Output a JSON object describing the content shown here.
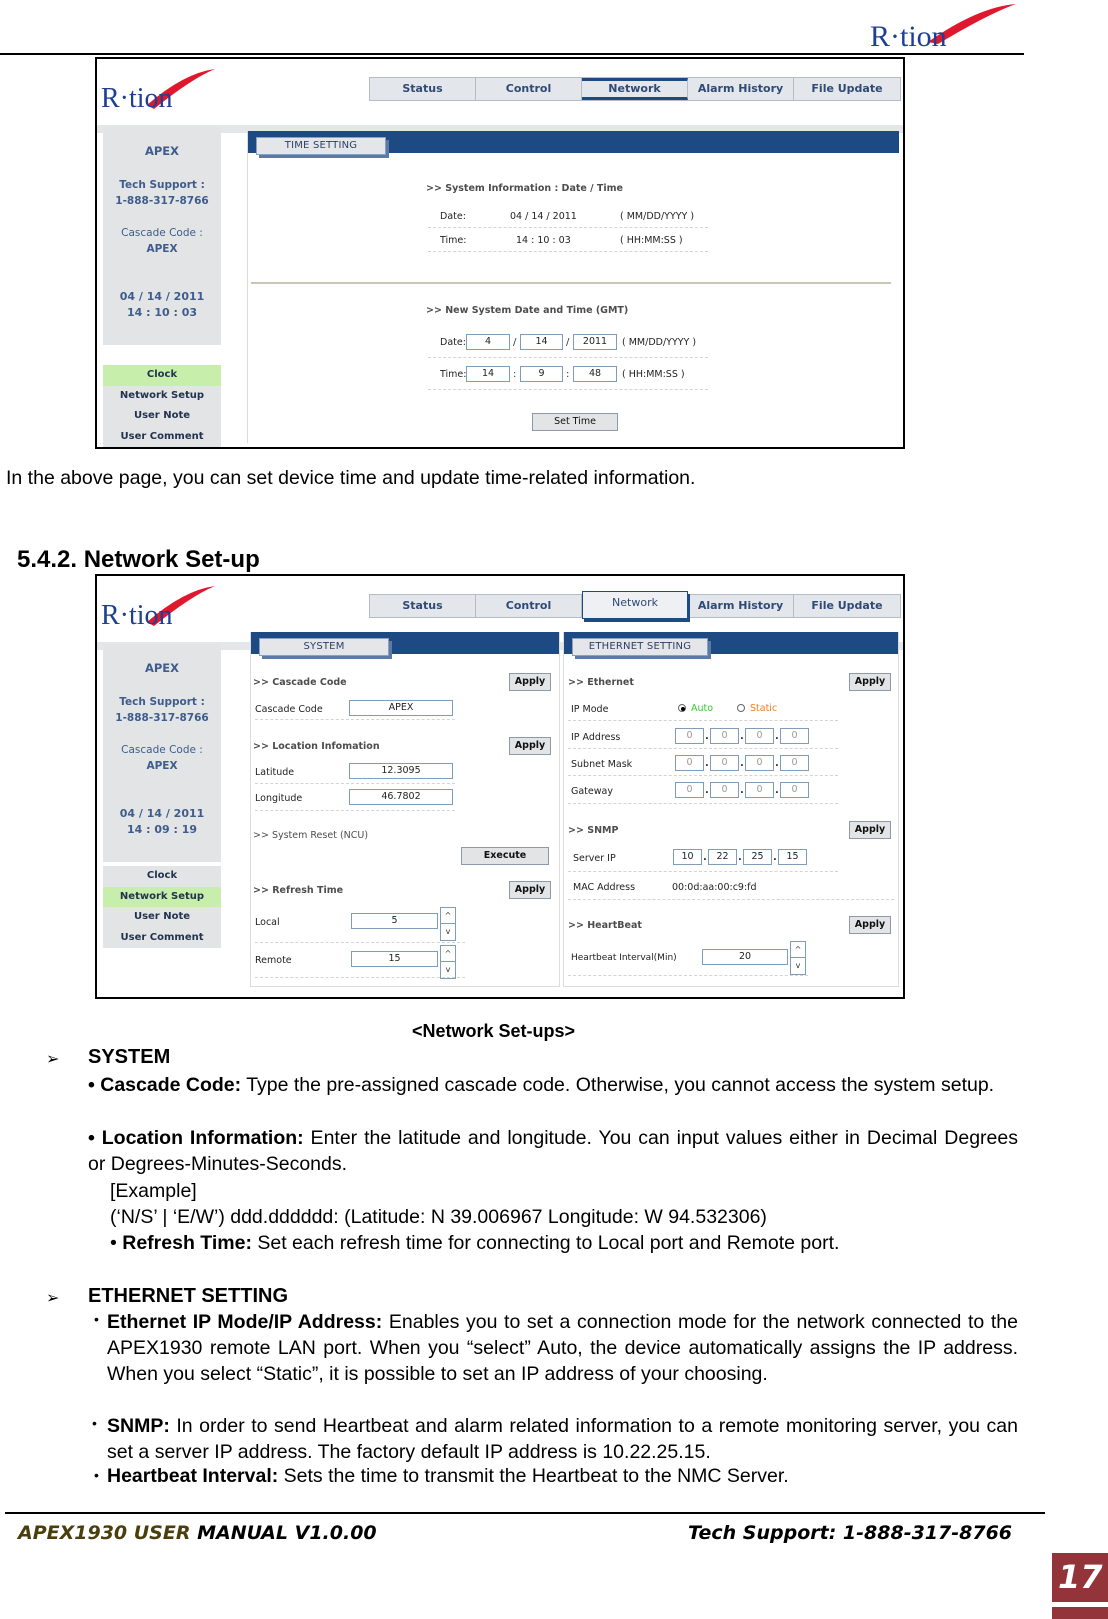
{
  "header": {
    "brand": "R·tion"
  },
  "shot1": {
    "nav_tabs": [
      {
        "label": "Status"
      },
      {
        "label": "Control"
      },
      {
        "label": "Network"
      },
      {
        "label": "Alarm History"
      },
      {
        "label": "File Update"
      }
    ],
    "active_tab": "Network",
    "sidebar_info": {
      "name": "APEX",
      "tech_support_label": "Tech Support :",
      "tech_support_phone": "1-888-317-8766",
      "cascade_label": "Cascade Code :",
      "cascade_value": "APEX",
      "date": "04 / 14 / 2011",
      "time": "14 : 10 : 03"
    },
    "sidebar_menu": [
      {
        "label": "Clock",
        "active": true
      },
      {
        "label": "Network Setup"
      },
      {
        "label": "User Note"
      },
      {
        "label": "User Comment"
      }
    ],
    "panel_title": "TIME SETTING",
    "sysinfo": {
      "title": ">> System Information : Date / Time",
      "date_label": "Date:",
      "date_value": "04 / 14 / 2011",
      "date_format": "( MM/DD/YYYY )",
      "time_label": "Time:",
      "time_value": "14 : 10 : 03",
      "time_format": "( HH:MM:SS )"
    },
    "newtime": {
      "title": ">> New System Date and Time (GMT)",
      "date_label": "Date:",
      "month": "4",
      "day": "14",
      "year": "2011",
      "date_sep": "/",
      "date_format": "( MM/DD/YYYY )",
      "time_label": "Time:",
      "hour": "14",
      "minute": "9",
      "second": "48",
      "time_sep": ":",
      "time_format": "( HH:MM:SS )",
      "button": "Set Time"
    }
  },
  "text1": "In the above page, you can set device time and update time-related information.",
  "section_heading": "5.4.2. Network Set-up",
  "shot2": {
    "nav_tabs": [
      {
        "label": "Status"
      },
      {
        "label": "Control"
      },
      {
        "label": "Network"
      },
      {
        "label": "Alarm History"
      },
      {
        "label": "File Update"
      }
    ],
    "sidebar_info": {
      "name": "APEX",
      "tech_support_label": "Tech Support :",
      "tech_support_phone": "1-888-317-8766",
      "cascade_label": "Cascade Code :",
      "cascade_value": "APEX",
      "date": "04 / 14 / 2011",
      "time": "14 : 09 : 19"
    },
    "sidebar_menu": [
      {
        "label": "Clock"
      },
      {
        "label": "Network Setup",
        "active": true
      },
      {
        "label": "User Note"
      },
      {
        "label": "User Comment"
      }
    ],
    "system": {
      "panel_title": "SYSTEM",
      "cascade_title": ">> Cascade Code",
      "cascade_label": "Cascade Code",
      "cascade_value": "APEX",
      "location_title": ">> Location Infomation",
      "lat_label": "Latitude",
      "lat_value": "12.3095",
      "lon_label": "Longitude",
      "lon_value": "46.7802",
      "reset_title": ">> System Reset (NCU)",
      "execute": "Execute",
      "refresh_title": ">> Refresh Time",
      "local_label": "Local",
      "local_value": "5",
      "remote_label": "Remote",
      "remote_value": "15",
      "apply": "Apply",
      "spin_up": "^",
      "spin_down": "v"
    },
    "ethernet": {
      "panel_title": "ETHERNET SETTING",
      "eth_title": ">> Ethernet",
      "ip_mode_label": "IP Mode",
      "auto": "Auto",
      "static": "Static",
      "mode_selected": "Auto",
      "auto_color": "#33cc33",
      "static_color": "#ff7a1a",
      "ip_label": "IP Address",
      "ip": [
        "0",
        "0",
        "0",
        "0"
      ],
      "mask_label": "Subnet Mask",
      "mask": [
        "0",
        "0",
        "0",
        "0"
      ],
      "gw_label": "Gateway",
      "gw": [
        "0",
        "0",
        "0",
        "0"
      ],
      "snmp_title": ">> SNMP",
      "server_label": "Server IP",
      "server": [
        "10",
        "22",
        "25",
        "15"
      ],
      "mac_label": "MAC Address",
      "mac_value": "00:0d:aa:00:c9:fd",
      "hb_title": ">> HeartBeat",
      "hb_label": "Heartbeat Interval(Min)",
      "hb_value": "20",
      "apply": "Apply",
      "dot": "."
    }
  },
  "caption": "<Network Set-ups>",
  "system_section": {
    "heading": "SYSTEM",
    "cascade_bold": "• Cascade Code:",
    "cascade_text": " Type the pre-assigned cascade code. Otherwise, you cannot access the system setup.",
    "location_bold": "• Location Information:",
    "location_text": " Enter the latitude and longitude. You can input values either in Decimal Degrees or Degrees-Minutes-Seconds.",
    "example_label": "[Example]",
    "example_text": "(‘N/S’ | ‘E/W’) ddd.dddddd: (Latitude: N 39.006967 Longitude: W 94.532306)",
    "refresh_bullet": "• ",
    "refresh_bold": "Refresh Time:",
    "refresh_text": " Set each refresh time for connecting to Local port and Remote port."
  },
  "ethernet_section": {
    "heading": "ETHERNET SETTING",
    "ip_bold": "Ethernet IP Mode/IP Address:",
    "ip_text": " Enables you to set a connection mode for the network connected to the APEX1930 remote LAN port. When you “select” Auto, the device automatically assigns the IP address. When you select “Static”, it is possible to set an IP address of your choosing.",
    "snmp_bold": "SNMP:",
    "snmp_text": " In order to send Heartbeat and alarm related information to a remote monitoring server, you can set a server IP address. The factory default IP address is 10.22.25.15.",
    "hb_bold": "Heartbeat Interval:",
    "hb_text": " Sets the time to transmit the Heartbeat to the NMC Server.",
    "bullet": "•"
  },
  "footer": {
    "left_a": "APEX1930 USER",
    "left_b": " MANUAL V1.0.00",
    "right": "Tech Support: 1-888-317-8766",
    "page": "17"
  },
  "arrow_glyph": "➢"
}
